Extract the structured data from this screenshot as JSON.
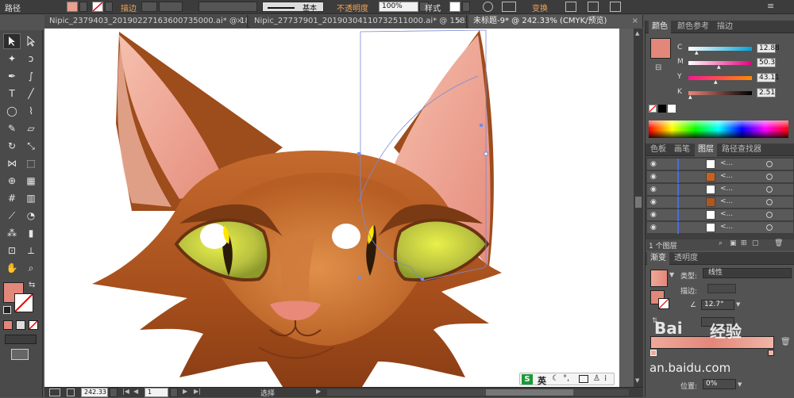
{
  "app": {
    "control_bar": {
      "mode_label": "路径",
      "stroke_label": "描边",
      "stroke_style": "基本",
      "opacity_label": "不透明度",
      "opacity_value": "100%",
      "style_label": "样式",
      "transform_label": "变换"
    },
    "tabs": [
      {
        "label": "Nipic_2379403_20190227163600735000.ai* @ 180...",
        "close": "×"
      },
      {
        "label": "Nipic_27737901_20190304110732511000.ai* @ 158...",
        "close": "×"
      },
      {
        "label": "未标题-9* @ 242.33% (CMYK/预览)",
        "close": "×"
      }
    ],
    "status_bar": {
      "zoom": "242.33",
      "artboard": "1",
      "mode": "选择"
    },
    "ime_bar": {
      "logo": "S",
      "lang": "英"
    },
    "watermark": {
      "brand": "Bai",
      "brand_cn": "经验",
      "url": "an.baidu.com"
    }
  },
  "panels": {
    "color": {
      "tabs": [
        "颜色",
        "颜色参考",
        "描边"
      ],
      "channels": [
        {
          "label": "C",
          "value": "12.88",
          "track": [
            "#ffffff",
            "#00a3d9"
          ]
        },
        {
          "label": "M",
          "value": "50.3",
          "track": [
            "#ffffff",
            "#e4007f"
          ]
        },
        {
          "label": "Y",
          "value": "43.11",
          "track": [
            "#ffffff",
            "#ffe100"
          ]
        },
        {
          "label": "K",
          "value": "2.51",
          "track": [
            "#ffffff",
            "#000000"
          ]
        }
      ],
      "fill_color": "#e3877a"
    },
    "layers": {
      "tabs": [
        "色板",
        "画笔",
        "图层",
        "路径查找器"
      ],
      "rows": [
        {
          "name": "<..."
        },
        {
          "name": "<..."
        },
        {
          "name": "<..."
        },
        {
          "name": "<..."
        },
        {
          "name": "<..."
        },
        {
          "name": "<..."
        }
      ],
      "count_label": "1 个图层"
    },
    "gradient": {
      "tabs": [
        "渐变",
        "透明度"
      ],
      "type_label": "类型:",
      "type_value": "线性",
      "stroke_label": "描边:",
      "angle_value": "12.7°",
      "location_label": "位置:",
      "location_value": "0%"
    }
  }
}
